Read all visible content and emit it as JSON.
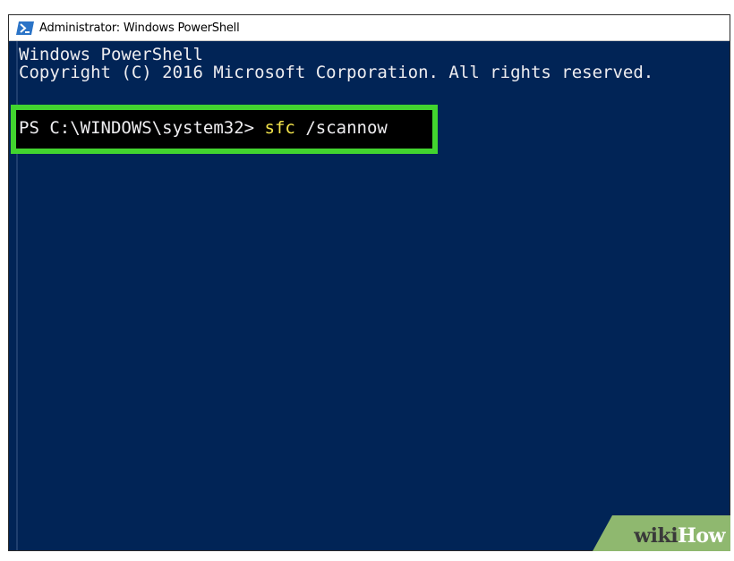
{
  "window": {
    "title": "Administrator: Windows PowerShell",
    "icon": "powershell-icon"
  },
  "console": {
    "header_line_1": "Windows PowerShell",
    "header_line_2": "Copyright (C) 2016 Microsoft Corporation. All rights reserved.",
    "prompt": "PS C:\\WINDOWS\\system32> ",
    "command": "sfc",
    "argument": " /scannow"
  },
  "watermark": {
    "part1": "wiki",
    "part2": "How"
  },
  "colors": {
    "console_background": "#012456",
    "console_text": "#eeedf0",
    "command_text": "#f2e34b",
    "highlight_border": "#42d42f",
    "watermark_green": "#8fb86f"
  }
}
